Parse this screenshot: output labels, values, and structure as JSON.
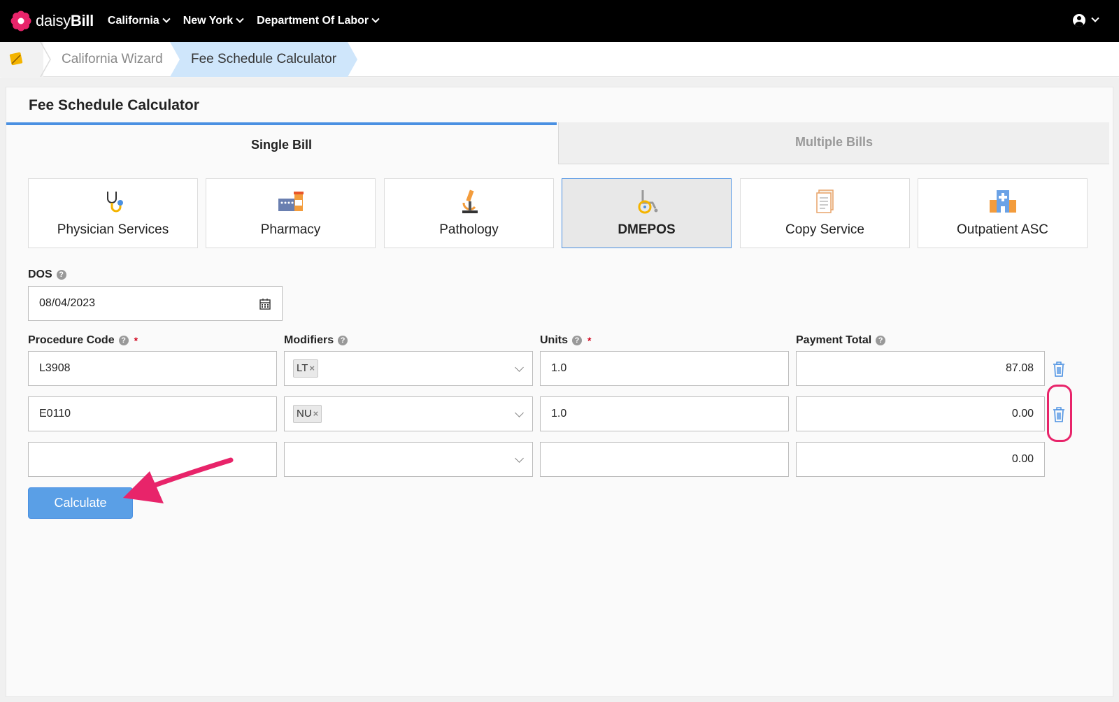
{
  "nav": {
    "logo_prefix": "daisy",
    "logo_suffix": "Bill",
    "menus": [
      "California",
      "New York",
      "Department Of Labor"
    ]
  },
  "breadcrumb": {
    "items": [
      "California Wizard",
      "Fee Schedule Calculator"
    ]
  },
  "page": {
    "title": "Fee Schedule Calculator",
    "tabs": [
      "Single Bill",
      "Multiple Bills"
    ],
    "active_tab": "Single Bill"
  },
  "services": [
    {
      "label": "Physician Services",
      "icon": "stethoscope-icon"
    },
    {
      "label": "Pharmacy",
      "icon": "pharmacy-icon"
    },
    {
      "label": "Pathology",
      "icon": "microscope-icon"
    },
    {
      "label": "DMEPOS",
      "icon": "wheelchair-icon"
    },
    {
      "label": "Copy Service",
      "icon": "document-icon"
    },
    {
      "label": "Outpatient ASC",
      "icon": "hospital-icon"
    }
  ],
  "active_service": "DMEPOS",
  "form": {
    "dos_label": "DOS",
    "dos_value": "08/04/2023",
    "headers": {
      "procedure": "Procedure Code",
      "modifiers": "Modifiers",
      "units": "Units",
      "payment": "Payment Total"
    },
    "required_mark": "*",
    "help_mark": "?",
    "remove_tag_mark": "×",
    "rows": [
      {
        "procedure": "L3908",
        "modifier": "LT",
        "units": "1.0",
        "payment": "87.08"
      },
      {
        "procedure": "E0110",
        "modifier": "NU",
        "units": "1.0",
        "payment": "0.00"
      },
      {
        "procedure": "",
        "modifier": "",
        "units": "",
        "payment": "0.00"
      }
    ],
    "calculate_label": "Calculate"
  },
  "colors": {
    "accent": "#4a90e2",
    "button": "#5a9fe6",
    "annotation": "#e8246a",
    "nav_bg": "#000000",
    "active_crumb": "#cfe6fb"
  }
}
